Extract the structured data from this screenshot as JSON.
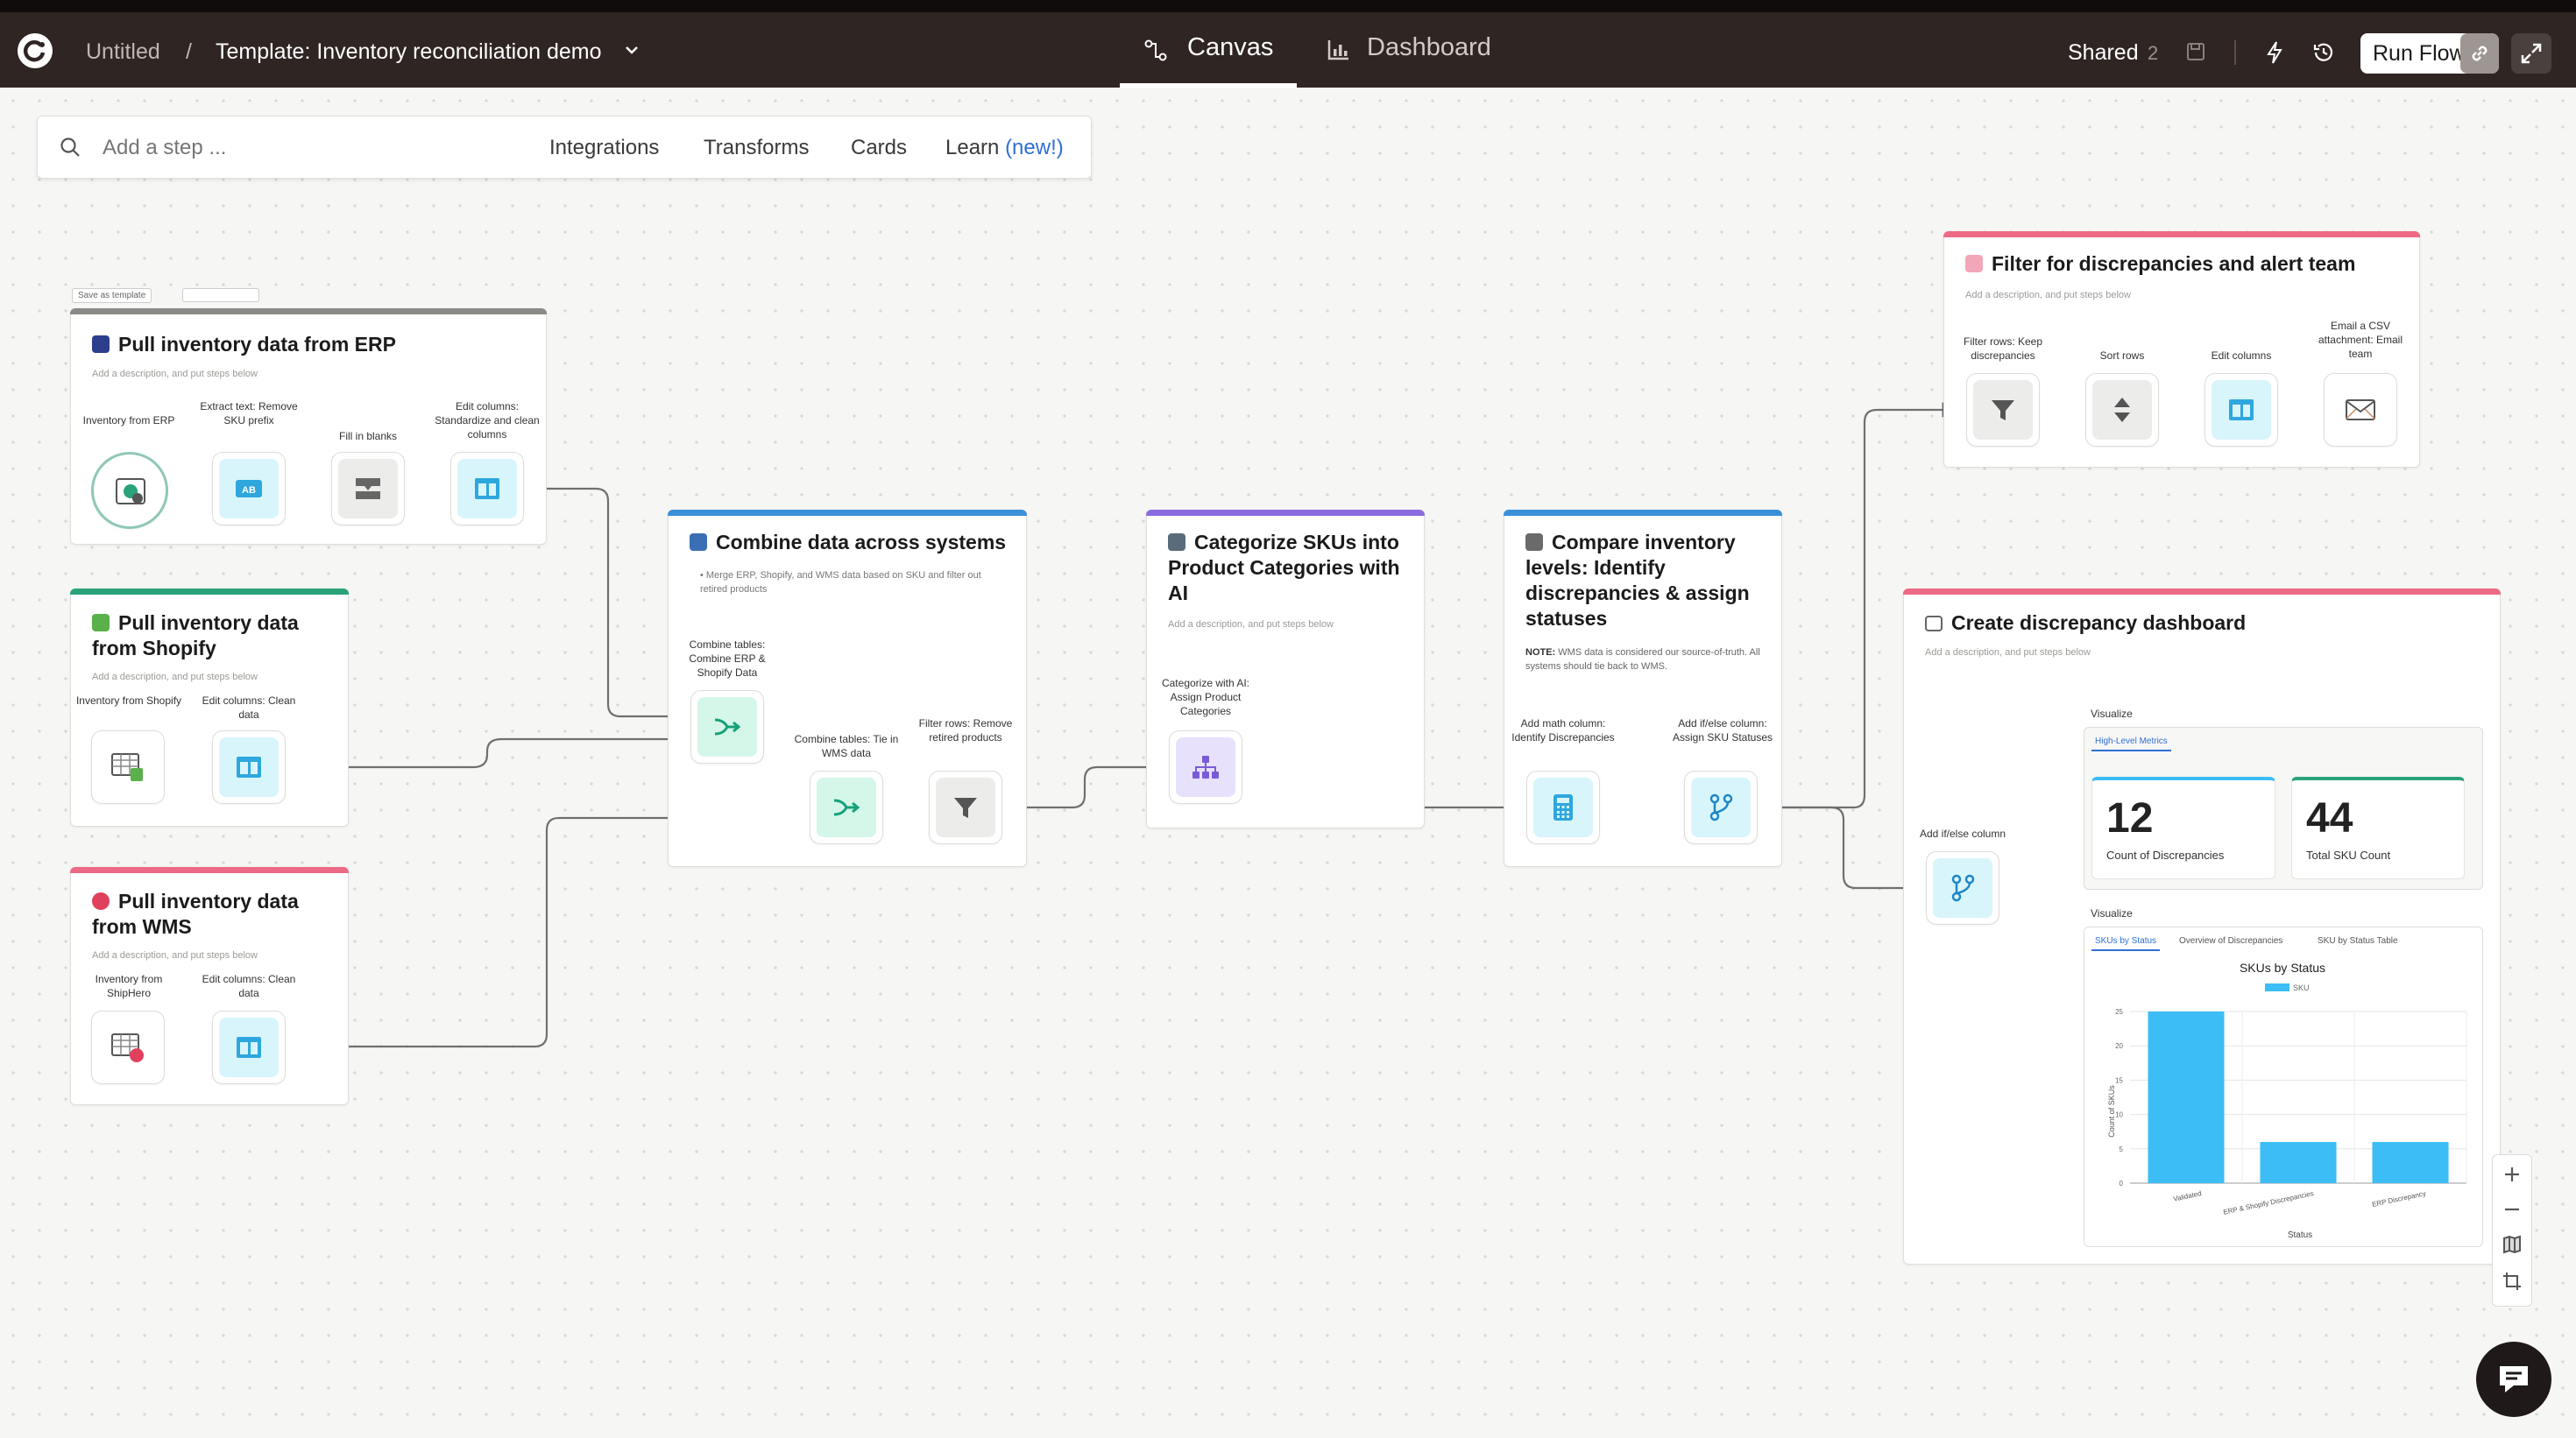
{
  "header": {
    "breadcrumb_root": "Untitled",
    "breadcrumb_sep": "/",
    "title": "Template: Inventory reconciliation demo",
    "tabs": [
      {
        "label": "Canvas"
      },
      {
        "label": "Dashboard"
      }
    ],
    "shared_label": "Shared",
    "shared_count": "2",
    "run_label": "Run Flow"
  },
  "toolbar": {
    "placeholder": "Add a step ...",
    "integrations": "Integrations",
    "transforms": "Transforms",
    "cards": "Cards",
    "learn": "Learn",
    "learn_new": "(new!)"
  },
  "cards": {
    "erp": {
      "title": "Pull inventory data from ERP",
      "desc": "Add a description, and put steps below",
      "hover_label": "Save as template",
      "steps": [
        "Inventory from ERP",
        "Extract text: Remove SKU prefix",
        "Fill in blanks",
        "Edit columns: Standardize and clean columns"
      ]
    },
    "shopify": {
      "title": "Pull inventory data from Shopify",
      "desc": "Add a description, and put steps below",
      "steps": [
        "Inventory from Shopify",
        "Edit columns: Clean data"
      ]
    },
    "wms": {
      "title": "Pull inventory data from WMS",
      "desc": "Add a description, and put steps below",
      "steps": [
        "Inventory from ShipHero",
        "Edit columns: Clean data"
      ]
    },
    "combine": {
      "title": "Combine data across systems",
      "desc": "• Merge ERP, Shopify, and WMS data based on SKU and filter out retired products",
      "steps": [
        "Combine tables: Combine ERP & Shopify Data",
        "Combine tables: Tie in WMS data",
        "Filter rows: Remove retired products"
      ]
    },
    "categorize": {
      "title": "Categorize SKUs into Product Categories with AI",
      "desc": "Add a description, and put steps below",
      "steps": [
        "Categorize with AI: Assign Product Categories"
      ]
    },
    "compare": {
      "title": "Compare inventory levels: Identify discrepancies & assign statuses",
      "note_bold": "NOTE:",
      "note": "WMS data is considered our source-of-truth. All systems should tie back to WMS.",
      "steps": [
        "Add math column: Identify Discrepancies",
        "Add if/else column: Assign SKU Statuses"
      ]
    },
    "filter": {
      "title": "Filter for discrepancies and alert team",
      "desc": "Add a description, and put steps below",
      "steps": [
        "Filter rows: Keep discrepancies",
        "Sort rows",
        "Edit columns",
        "Email a CSV attachment: Email team"
      ]
    },
    "dashboard": {
      "title": "Create discrepancy dashboard",
      "desc": "Add a description, and put steps below",
      "step": "Add if/else column",
      "visualize1": "Visualize",
      "visualize2": "Visualize",
      "tab_metrics": "High-Level Metrics",
      "metrics": [
        {
          "value": "12",
          "label": "Count of Discrepancies"
        },
        {
          "value": "44",
          "label": "Total SKU Count"
        }
      ],
      "chart_tabs": [
        "SKUs by Status",
        "Overview of Discrepancies",
        "SKU by Status Table"
      ]
    }
  },
  "colors": {
    "erp": "#8a8a86",
    "shopify": "#2aa37a",
    "wms": "#ec6a85",
    "combine": "#3b8fd9",
    "categorize": "#8b6be0",
    "compare": "#3b8fd9",
    "filter": "#ec6a85",
    "dashboard": "#ec6a85",
    "bar": "#3dbdf5"
  },
  "chart_data": {
    "type": "bar",
    "title": "SKUs by Status",
    "xlabel": "Status",
    "ylabel": "Count of SKUs",
    "categories": [
      "Validated",
      "ERP & Shopify Discrepancies",
      "ERP Discrepancy"
    ],
    "series": [
      {
        "name": "SKU",
        "values": [
          25,
          6,
          6
        ]
      }
    ],
    "ylim": [
      0,
      25
    ],
    "yticks": [
      0,
      5,
      10,
      15,
      20,
      25
    ]
  }
}
